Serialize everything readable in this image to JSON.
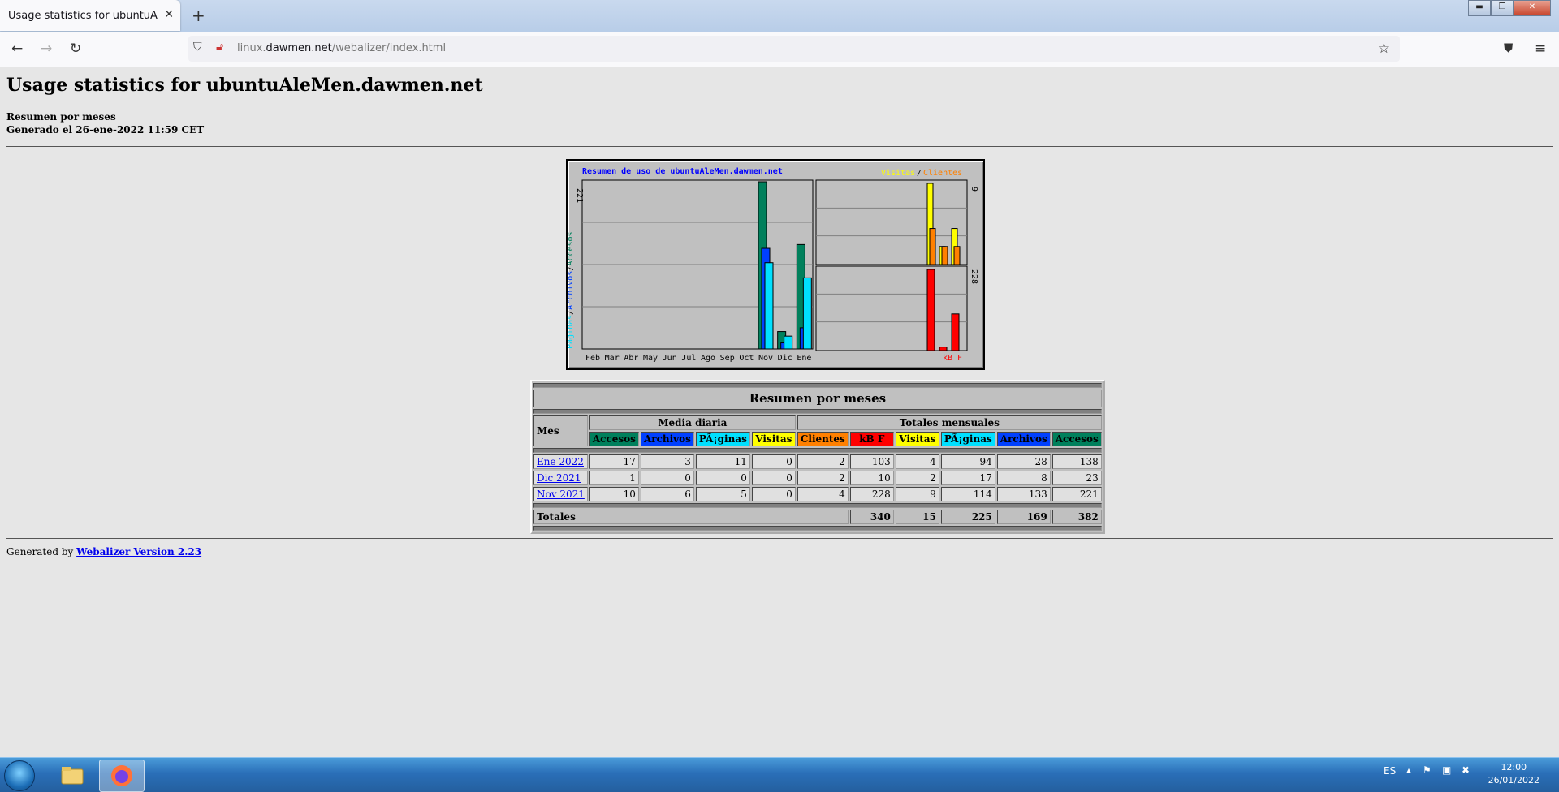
{
  "browser": {
    "tab_title": "Usage statistics for ubuntuAleMen.c",
    "tab_close": "✕",
    "new_tab": "+",
    "url_prefix": "linux.",
    "url_domain": "dawmen.net",
    "url_path": "/webalizer/index.html",
    "win_min": "▬",
    "win_max": "❐",
    "win_close": "✕"
  },
  "page": {
    "title": "Usage statistics for ubuntuAleMen.dawmen.net",
    "subtitle": "Resumen por meses",
    "generated": "Generado el 26-ene-2022 11:59 CET"
  },
  "chart_data": {
    "type": "bar",
    "title": "Resumen de uso de ubuntuAleMen.dawmen.net",
    "legend_right": [
      "Visitas",
      "/",
      "Clientes"
    ],
    "left_axis_label": [
      "Páginas",
      "/",
      "Archivos",
      "/",
      "Accesos"
    ],
    "left_axis_max": "221",
    "right_top_max": "9",
    "right_bottom_max": "228",
    "right_bottom_label": "kB F",
    "categories": [
      "Feb",
      "Mar",
      "Abr",
      "May",
      "Jun",
      "Jul",
      "Ago",
      "Sep",
      "Oct",
      "Nov",
      "Dic",
      "Ene"
    ],
    "series": [
      {
        "name": "Accesos",
        "color": "#00805c",
        "values": [
          0,
          0,
          0,
          0,
          0,
          0,
          0,
          0,
          0,
          221,
          23,
          138
        ]
      },
      {
        "name": "Archivos",
        "color": "#0040ff",
        "values": [
          0,
          0,
          0,
          0,
          0,
          0,
          0,
          0,
          0,
          133,
          8,
          28
        ]
      },
      {
        "name": "Páginas",
        "color": "#00e0ff",
        "values": [
          0,
          0,
          0,
          0,
          0,
          0,
          0,
          0,
          0,
          114,
          17,
          94
        ]
      },
      {
        "name": "Visitas",
        "color": "#ffff00",
        "values": [
          0,
          0,
          0,
          0,
          0,
          0,
          0,
          0,
          0,
          9,
          2,
          4
        ]
      },
      {
        "name": "Clientes",
        "color": "#ff8000",
        "values": [
          0,
          0,
          0,
          0,
          0,
          0,
          0,
          0,
          0,
          4,
          2,
          2
        ]
      },
      {
        "name": "kB F",
        "color": "#ff0000",
        "values": [
          0,
          0,
          0,
          0,
          0,
          0,
          0,
          0,
          0,
          228,
          10,
          103
        ]
      }
    ]
  },
  "table": {
    "caption": "Resumen por meses",
    "col_mes": "Mes",
    "group_daily": "Media diaria",
    "group_monthly": "Totales mensuales",
    "headers": [
      {
        "label": "Accesos",
        "bg": "#00805c",
        "fg": "#000000"
      },
      {
        "label": "Archivos",
        "bg": "#0040ff",
        "fg": "#000000"
      },
      {
        "label": "PÃ¡ginas",
        "bg": "#00e0ff",
        "fg": "#000000"
      },
      {
        "label": "Visitas",
        "bg": "#ffff00",
        "fg": "#000000"
      },
      {
        "label": "Clientes",
        "bg": "#ff8000",
        "fg": "#000000"
      },
      {
        "label": "kB F",
        "bg": "#ff0000",
        "fg": "#000000"
      },
      {
        "label": "Visitas",
        "bg": "#ffff00",
        "fg": "#000000"
      },
      {
        "label": "PÃ¡ginas",
        "bg": "#00e0ff",
        "fg": "#000000"
      },
      {
        "label": "Archivos",
        "bg": "#0040ff",
        "fg": "#000000"
      },
      {
        "label": "Accesos",
        "bg": "#00805c",
        "fg": "#000000"
      }
    ],
    "rows": [
      {
        "month": "Ene 2022",
        "values": [
          "17",
          "3",
          "11",
          "0",
          "2",
          "103",
          "4",
          "94",
          "28",
          "138"
        ]
      },
      {
        "month": "Dic 2021",
        "values": [
          "1",
          "0",
          "0",
          "0",
          "2",
          "10",
          "2",
          "17",
          "8",
          "23"
        ]
      },
      {
        "month": "Nov 2021",
        "values": [
          "10",
          "6",
          "5",
          "0",
          "4",
          "228",
          "9",
          "114",
          "133",
          "221"
        ]
      }
    ],
    "totals_label": "Totales",
    "totals": [
      "340",
      "15",
      "225",
      "169",
      "382"
    ]
  },
  "footer": {
    "prefix": "Generated by ",
    "link": "Webalizer Version 2.23"
  },
  "taskbar": {
    "lang": "ES",
    "time": "12:00",
    "date": "26/01/2022"
  }
}
